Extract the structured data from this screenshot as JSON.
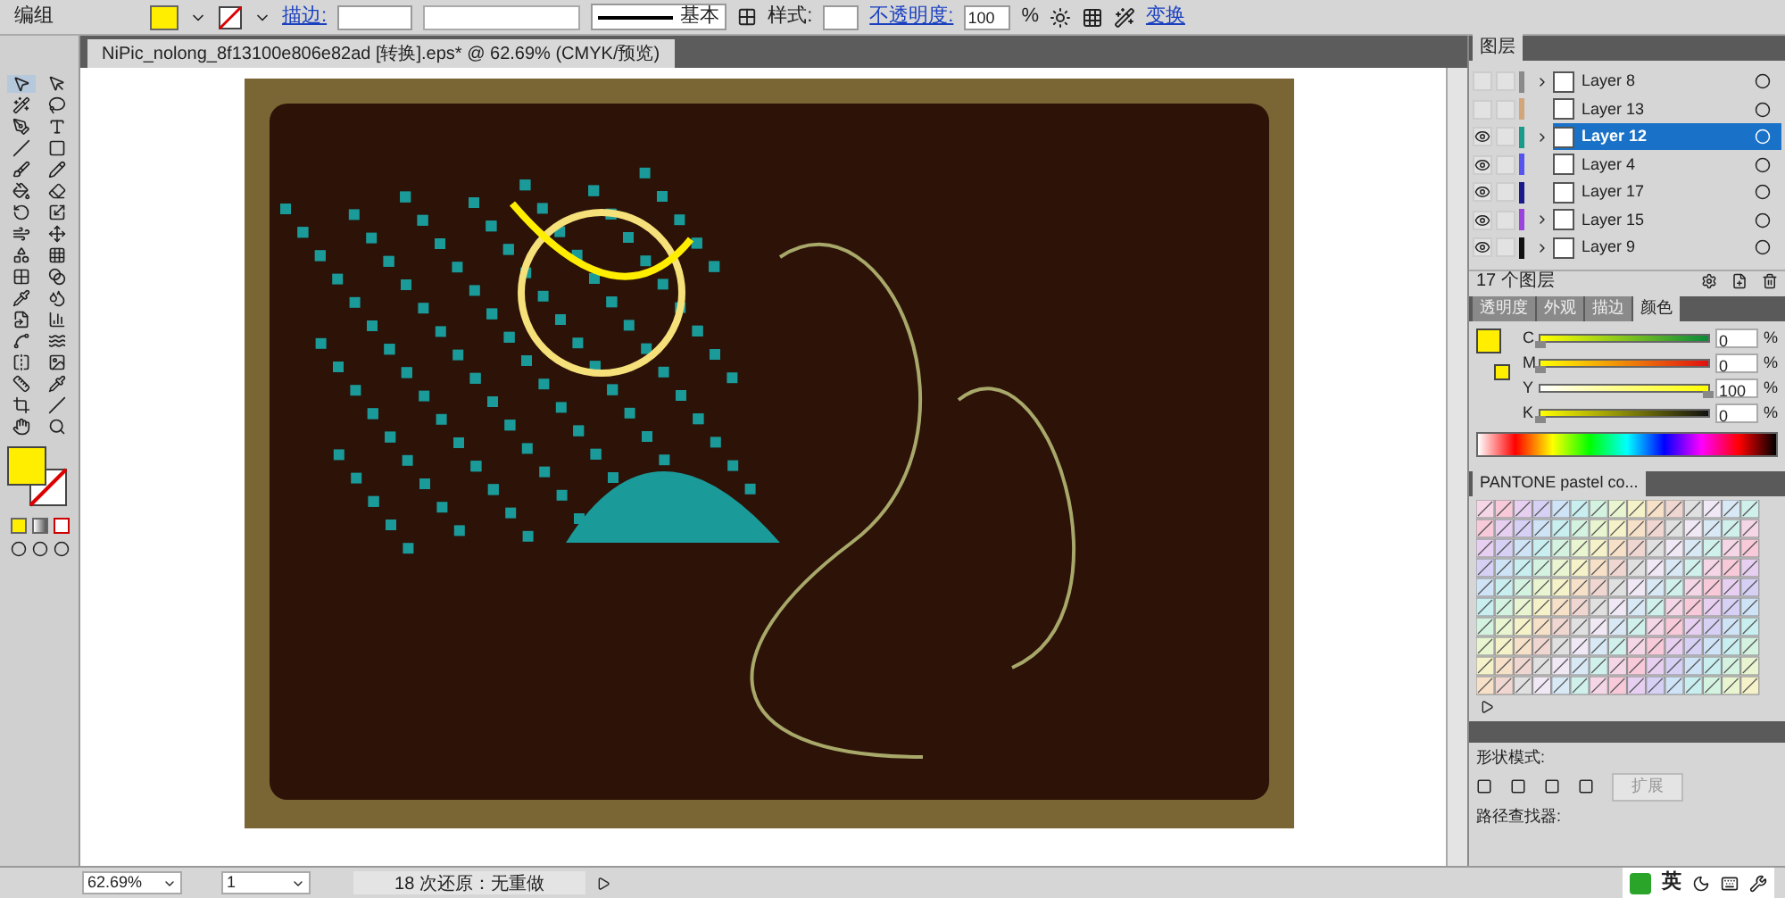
{
  "control_bar": {
    "label": "编组",
    "stroke_label": "描边:",
    "stroke_style": "基本",
    "style_label": "样式:",
    "opacity_label": "不透明度:",
    "opacity_value": "100",
    "percent": "%",
    "transform_link": "变换"
  },
  "document_tab": {
    "title": "NiPic_nolong_8f13100e806e82ad [转换].eps* @ 62.69% (CMYK/预览)"
  },
  "layers_panel": {
    "title": "图层",
    "layers": [
      {
        "name": "Layer 8",
        "visible": false,
        "color": "#8a8a8a",
        "selected": false,
        "expandable": true
      },
      {
        "name": "Layer 13",
        "visible": false,
        "color": "#d2a57a",
        "selected": false,
        "expandable": false
      },
      {
        "name": "Layer 12",
        "visible": true,
        "color": "#1a9a8a",
        "selected": true,
        "expandable": true
      },
      {
        "name": "Layer 4",
        "visible": true,
        "color": "#5555ee",
        "selected": false,
        "expandable": false
      },
      {
        "name": "Layer 17",
        "visible": true,
        "color": "#1a1a8a",
        "selected": false,
        "expandable": false
      },
      {
        "name": "Layer 15",
        "visible": true,
        "color": "#9a44dd",
        "selected": false,
        "expandable": true
      },
      {
        "name": "Layer 9",
        "visible": true,
        "color": "#111111",
        "selected": false,
        "expandable": true
      }
    ],
    "count": "17 个图层"
  },
  "color_panel": {
    "tabs": [
      {
        "label": "透明度",
        "selected": false
      },
      {
        "label": "外观",
        "selected": false
      },
      {
        "label": "描边",
        "selected": false
      },
      {
        "label": "颜色",
        "selected": true
      }
    ],
    "channels": [
      {
        "name": "C",
        "value": "0",
        "level": 0
      },
      {
        "name": "M",
        "value": "0",
        "level": 0
      },
      {
        "name": "Y",
        "value": "100",
        "level": 1
      },
      {
        "name": "K",
        "value": "0",
        "level": 0
      }
    ],
    "unit": "%"
  },
  "swatches_panel": {
    "title": "PANTONE pastel co..."
  },
  "pathfinder_panel": {
    "shape_modes_label": "形状模式:",
    "pathfinders_label": "路径查找器:",
    "expand_button": "扩展"
  },
  "status_bar": {
    "zoom": "62.69%",
    "page": "1",
    "status": "18 次还原：无重做"
  },
  "taskbar": {
    "ime_label": "英"
  }
}
